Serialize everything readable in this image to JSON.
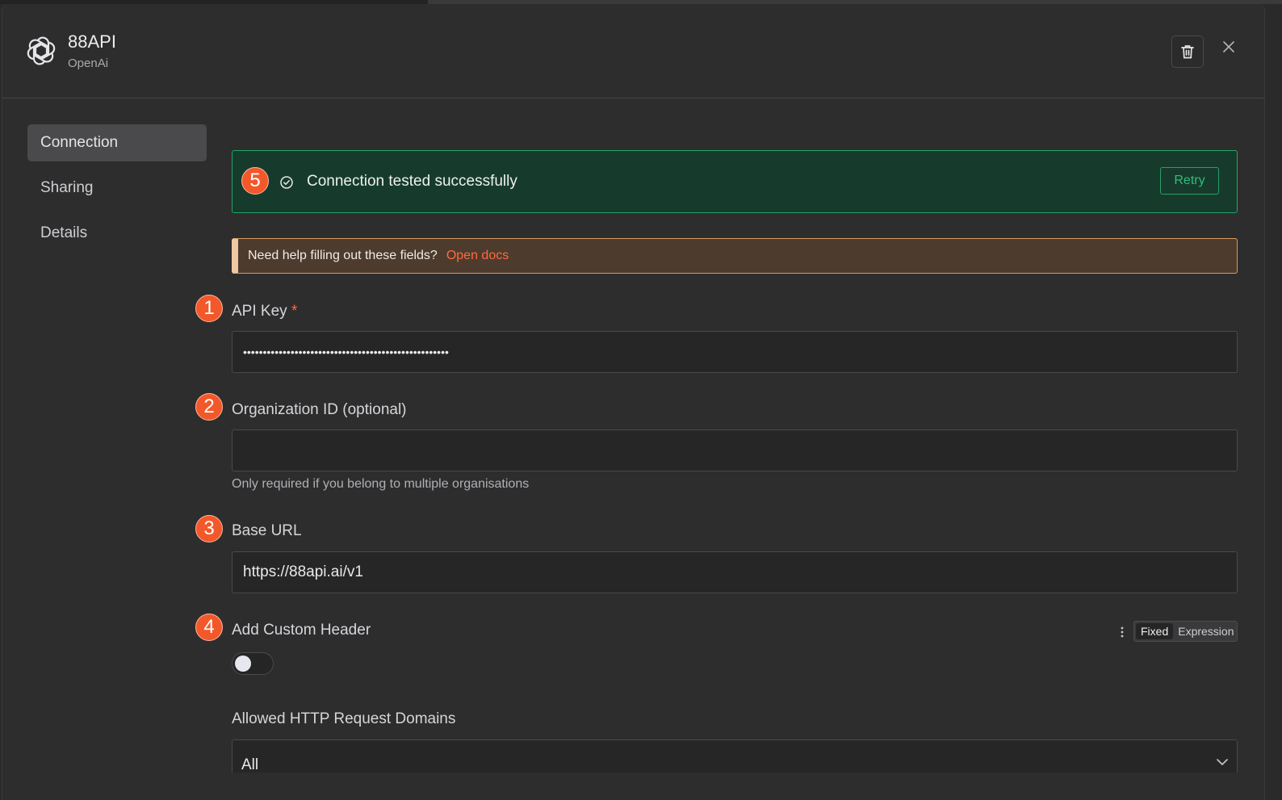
{
  "header": {
    "title": "88API",
    "subtitle": "OpenAi",
    "logo_icon": "openai-logo-icon",
    "delete_icon": "trash-icon",
    "close_icon": "close-icon"
  },
  "sidebar": {
    "items": [
      {
        "label": "Connection",
        "active": true
      },
      {
        "label": "Sharing",
        "active": false
      },
      {
        "label": "Details",
        "active": false
      }
    ]
  },
  "success_banner": {
    "step": "5",
    "message": "Connection tested successfully",
    "retry_label": "Retry"
  },
  "help_banner": {
    "text": "Need help filling out these fields?",
    "link_label": "Open docs"
  },
  "fields": {
    "api_key": {
      "step": "1",
      "label": "API Key",
      "required_mark": "*",
      "value": "••••••••••••••••••••••••••••••••••••••••••••••••••••"
    },
    "organization_id": {
      "step": "2",
      "label": "Organization ID (optional)",
      "value": "",
      "hint": "Only required if you belong to multiple organisations"
    },
    "base_url": {
      "step": "3",
      "label": "Base URL",
      "value": "https://88api.ai/v1"
    },
    "custom_header": {
      "step": "4",
      "label": "Add Custom Header",
      "enabled": false,
      "mode_fixed": "Fixed",
      "mode_expression": "Expression",
      "active_mode": "Fixed"
    },
    "allowed_domains": {
      "label": "Allowed HTTP Request Domains",
      "value": "All"
    }
  },
  "colors": {
    "accent": "#ff6a3d",
    "badge": "#f2582a",
    "success_bg": "#163b2d",
    "success_border": "#22a566",
    "warning_bg": "#4d3b2d"
  }
}
